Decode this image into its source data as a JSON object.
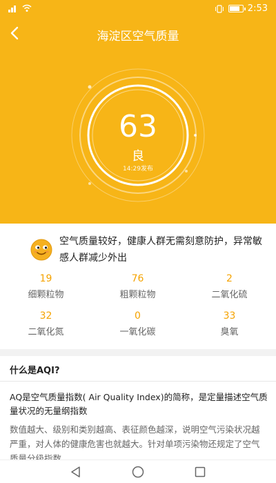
{
  "status_bar": {
    "time": "2:53"
  },
  "header": {
    "title": "海淀区空气质量"
  },
  "aqi": {
    "value": "63",
    "level": "良",
    "publish_time": "14:29发布"
  },
  "summary": {
    "text": "空气质量较好，健康人群无需刻意防护，异常敏感人群减少外出"
  },
  "pollutants": [
    {
      "value": "19",
      "name": "细颗粒物"
    },
    {
      "value": "76",
      "name": "粗颗粒物"
    },
    {
      "value": "2",
      "name": "二氧化硫"
    },
    {
      "value": "32",
      "name": "二氧化氮"
    },
    {
      "value": "0",
      "name": "一氧化碳"
    },
    {
      "value": "33",
      "name": "臭氧"
    }
  ],
  "info": {
    "title": "什么是AQI?",
    "definition": "AQ是空气质量指数( Air Quality Index)的简称，是定量描述空气质量状况的无量纲指数",
    "detail": "数值越大、级别和类别越高、表征颜色越深，说明空气污染状况越严重，对人体的健康危害也就越大。针对单项污染物还规定了空气质量分级指数。"
  },
  "colors": {
    "primary": "#f7b517",
    "value_accent": "#f5a300"
  },
  "icons": [
    "back-arrow-icon",
    "smiley-face-icon",
    "nav-back-icon",
    "nav-home-icon",
    "nav-recent-icon"
  ]
}
